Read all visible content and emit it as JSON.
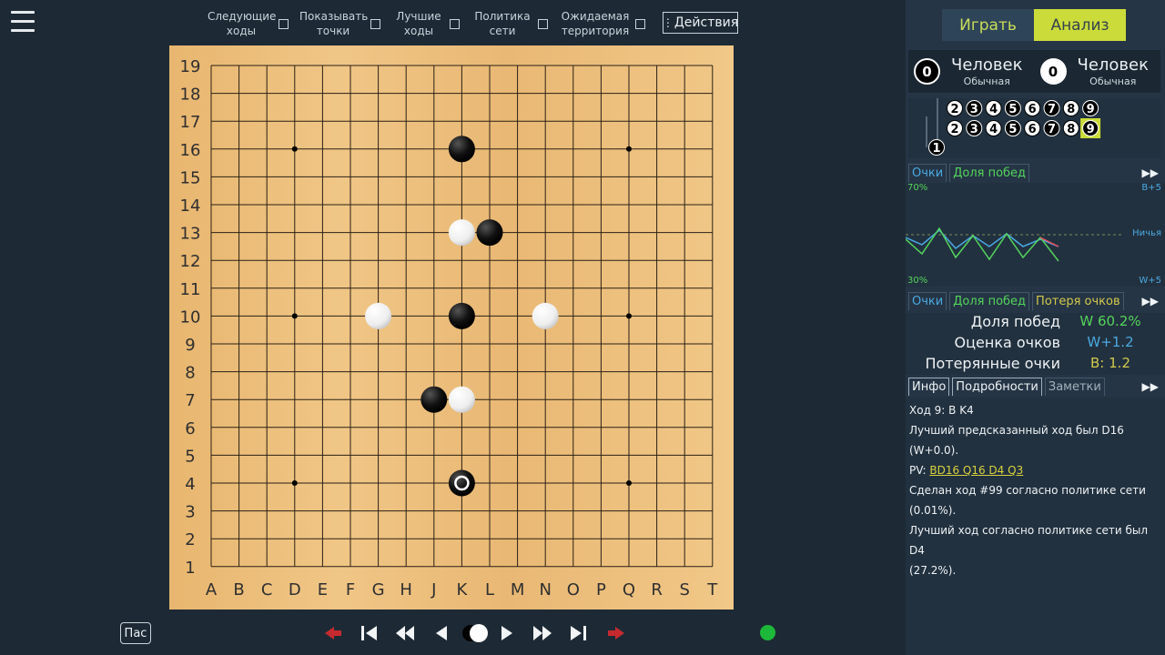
{
  "menu": {
    "icon": "hamburger-menu-icon"
  },
  "options": [
    {
      "label": "Следующие ходы"
    },
    {
      "label": "Показывать точки"
    },
    {
      "label": "Лучшие ходы"
    },
    {
      "label": "Политика сети"
    },
    {
      "label": "Ожидаемая территория"
    }
  ],
  "actions_label": "Действия",
  "board": {
    "size": 19,
    "columns": [
      "A",
      "B",
      "C",
      "D",
      "E",
      "F",
      "G",
      "H",
      "J",
      "K",
      "L",
      "M",
      "N",
      "O",
      "P",
      "Q",
      "R",
      "S",
      "T"
    ],
    "star_points": [
      "D4",
      "K4",
      "Q4",
      "D10",
      "K10",
      "Q10",
      "D16",
      "K16",
      "Q16"
    ],
    "black_stones": [
      "K16",
      "L13",
      "K10",
      "J7",
      "K4"
    ],
    "white_stones": [
      "K13",
      "G10",
      "N10",
      "K7"
    ],
    "last_move": "K4"
  },
  "bottom": {
    "pass_label": "Пас"
  },
  "mode_tabs": {
    "play": "Играть",
    "analysis": "Анализ"
  },
  "players": {
    "black": {
      "captures": "0",
      "name": "Человек",
      "level": "Обычная"
    },
    "white": {
      "captures": "0",
      "name": "Человек",
      "level": "Обычная"
    }
  },
  "tree": {
    "row1": [
      "2",
      "3",
      "4",
      "5",
      "6",
      "7",
      "8",
      "9"
    ],
    "row2": [
      "2",
      "3",
      "4",
      "5",
      "6",
      "7",
      "8",
      "9"
    ],
    "root": "1",
    "current_move": "9"
  },
  "graph_tabs": {
    "score": "Очки",
    "winrate": "Доля побед",
    "loss": "Потеря очков"
  },
  "graph": {
    "label_top_left": "70%",
    "label_top_right": "B+5",
    "label_mid_right": "Ничья",
    "label_bottom_left": "30%",
    "label_bottom_right": "W+5"
  },
  "stats": {
    "winrate_label": "Доля побед",
    "winrate_value": "W 60.2%",
    "score_label": "Оценка очков",
    "score_value": "W+1.2",
    "loss_label": "Потерянные очки",
    "loss_value": "B: 1.2"
  },
  "info_tabs": {
    "info": "Инфо",
    "details": "Подробности",
    "notes": "Заметки"
  },
  "info": {
    "move": "Ход 9: B K4",
    "best": "Лучший предсказанный ход был D16 (W+0.0).",
    "pv_label": "PV:",
    "pv_value": "BD16 Q16 D4 Q3",
    "policy1": "Сделан ход #99 согласно политике сети",
    "policy1b": "(0.01%).",
    "policy2": "Лучший ход согласно политике сети был D4",
    "policy2b": "(27.2%)."
  },
  "colors": {
    "accent": "#cbdc3a",
    "winrate": "#54d45c",
    "score": "#4aa9e2",
    "loss": "#d3c84c"
  }
}
